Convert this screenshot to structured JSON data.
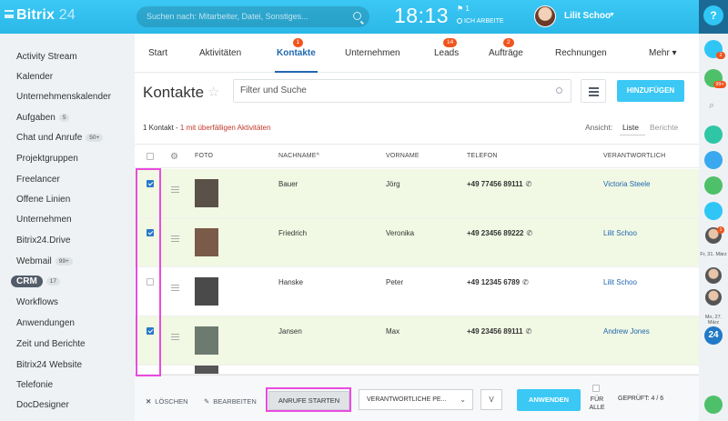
{
  "topbar": {
    "logo_main": "Bitrix",
    "logo_num": "24",
    "search_placeholder": "Suchen nach: Mitarbeiter, Datei, Sonstiges...",
    "clock": "18:13",
    "flag_count": "1",
    "work_status": "ICH ARBEITE",
    "user_name": "Lilit Schoo",
    "help": "?"
  },
  "sidebar": {
    "items": [
      {
        "label": "Activity Stream"
      },
      {
        "label": "Kalender"
      },
      {
        "label": "Unternehmenskalender"
      },
      {
        "label": "Aufgaben",
        "count": "5"
      },
      {
        "label": "Chat und Anrufe",
        "count": "50+"
      },
      {
        "label": "Projektgruppen"
      },
      {
        "label": "Freelancer"
      },
      {
        "label": "Offene Linien"
      },
      {
        "label": "Unternehmen"
      },
      {
        "label": "Bitrix24.Drive"
      },
      {
        "label": "Webmail",
        "count": "99+"
      },
      {
        "label": "CRM",
        "count": "17",
        "active": true
      },
      {
        "label": "Workflows"
      },
      {
        "label": "Anwendungen"
      },
      {
        "label": "Zeit und Berichte"
      },
      {
        "label": "Bitrix24 Website"
      },
      {
        "label": "Telefonie"
      },
      {
        "label": "DocDesigner"
      }
    ]
  },
  "tabs": [
    {
      "label": "Start"
    },
    {
      "label": "Aktivitäten"
    },
    {
      "label": "Kontakte",
      "badge": "1",
      "active": true
    },
    {
      "label": "Unternehmen"
    },
    {
      "label": "Leads",
      "badge": "14"
    },
    {
      "label": "Aufträge",
      "badge": "2"
    },
    {
      "label": "Rechnungen"
    },
    {
      "label": "Mehr ▾"
    }
  ],
  "page": {
    "title": "Kontakte",
    "filter_placeholder": "Filter und Suche",
    "add_button": "HINZUFÜGEN",
    "summary_count": "1 Kontakt - ",
    "summary_overdue": "1 mit überfälligen Aktivitäten",
    "view_label": "Ansicht:",
    "view_list": "Liste",
    "view_reports": "Berichte"
  },
  "table": {
    "headers": {
      "photo": "FOTO",
      "lastname": "NACHNAME^",
      "firstname": "VORNAME",
      "phone": "TELEFON",
      "owner": "VERANTWORTLICH"
    },
    "rows": [
      {
        "checked": true,
        "lastname": "Bauer",
        "firstname": "Jörg",
        "phone": "+49 77456 89111",
        "owner": "Victoria Steele"
      },
      {
        "checked": true,
        "lastname": "Friedrich",
        "firstname": "Veronika",
        "phone": "+49 23456 89222",
        "owner": "Lilit Schoo"
      },
      {
        "checked": false,
        "lastname": "Hanske",
        "firstname": "Peter",
        "phone": "+49 12345 6789",
        "owner": "Lilit Schoo"
      },
      {
        "checked": true,
        "lastname": "Jansen",
        "firstname": "Max",
        "phone": "+49 23456 89111",
        "owner": "Andrew Jones"
      }
    ]
  },
  "bottombar": {
    "delete": "LÖSCHEN",
    "edit": "BEARBEITEN",
    "start_calls": "ANRUFE STARTEN",
    "responsible_select": "VERANTWORTLICHE PE...",
    "apply": "ANWENDEN",
    "for_all": "FÜR ALLE",
    "checked": "GEPRÜFT: 4 / 6"
  },
  "rightbar": {
    "badge1": "2",
    "badge2": "99+",
    "badge3": "1",
    "date1": "Fr, 31. März",
    "date2": "Mo, 27. März",
    "app_label": "24"
  },
  "colors": {
    "accent": "#3bc8f5",
    "link": "#2067b0",
    "selected_row": "#f1f8e3",
    "highlight": "#e94bde",
    "badge": "#f0541e"
  }
}
